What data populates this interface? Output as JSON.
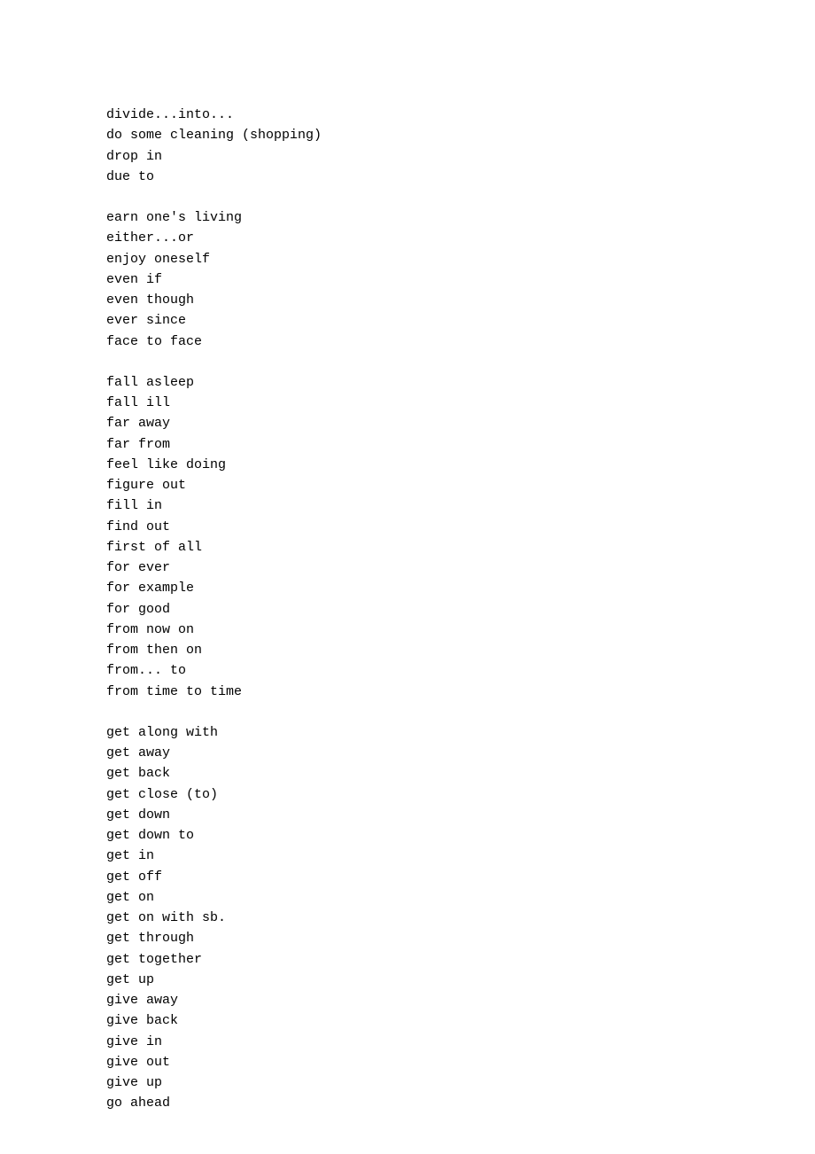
{
  "blocks": [
    {
      "lines": [
        "divide...into...",
        "do some cleaning (shopping)",
        "drop in",
        "due to"
      ]
    },
    {
      "lines": [
        "earn one's living",
        "either...or",
        "enjoy oneself",
        "even if",
        "even though",
        "ever since",
        "face to face"
      ]
    },
    {
      "lines": [
        "fall asleep",
        "fall ill",
        "far away",
        "far from",
        "feel like doing",
        "figure out",
        "fill in",
        "find out",
        "first of all",
        "for ever",
        "for example",
        "for good",
        "from now on",
        "from then on",
        "from... to",
        "from time to time"
      ]
    },
    {
      "lines": [
        "get along with",
        "get away",
        "get back",
        "get close (to)",
        "get down",
        "get down to",
        "get in",
        "get off",
        "get on",
        "get on with sb.",
        "get through",
        "get together",
        "get up",
        "give away",
        "give back",
        "give in",
        "give out",
        "give up",
        "go ahead"
      ]
    }
  ]
}
